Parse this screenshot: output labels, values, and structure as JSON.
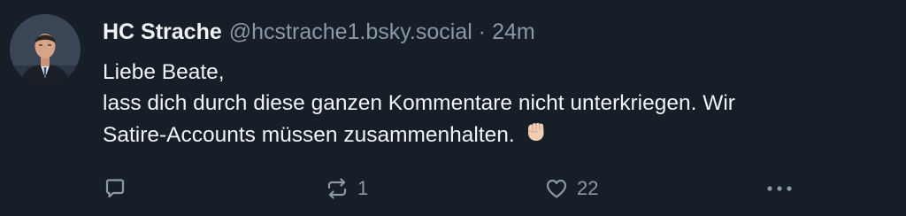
{
  "author": {
    "display_name": "HC Strache",
    "handle": "@hcstrache1.bsky.social",
    "separator": "·",
    "time": "24m",
    "avatar_icon": "profile-photo"
  },
  "post": {
    "text": "Liebe Beate,\nlass dich durch diese ganzen Kommentare nicht unterkriegen. Wir\nSatire-Accounts müssen zusammenhalten.",
    "emoji_icon": "raised-fist-emoji"
  },
  "actions": {
    "reply": {
      "icon": "reply-icon",
      "count": ""
    },
    "repost": {
      "icon": "repost-icon",
      "count": "1"
    },
    "like": {
      "icon": "heart-icon",
      "count": "22"
    },
    "more": {
      "icon": "more-icon"
    }
  },
  "colors": {
    "background": "#161e27",
    "text": "#f1f3f5",
    "muted": "#8b98a9"
  }
}
